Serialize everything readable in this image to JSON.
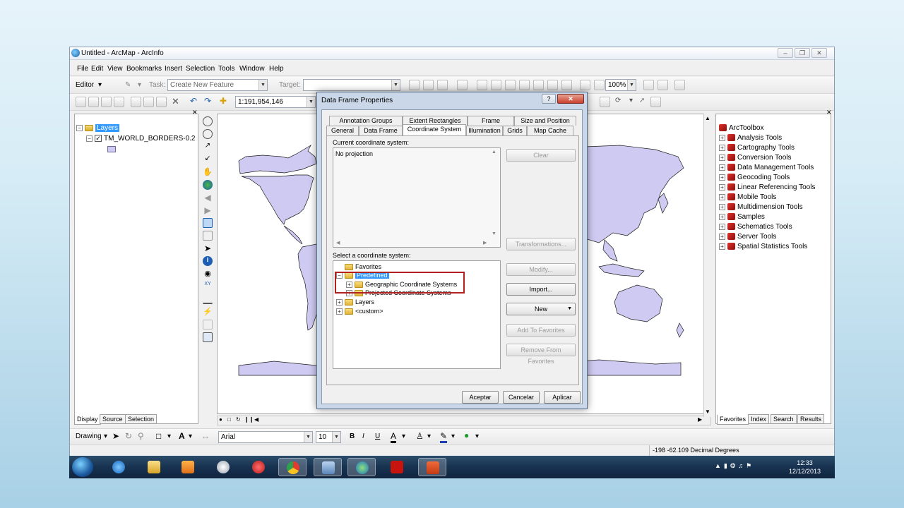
{
  "window": {
    "title": "Untitled - ArcMap - ArcInfo"
  },
  "menu": [
    "File",
    "Edit",
    "View",
    "Bookmarks",
    "Insert",
    "Selection",
    "Tools",
    "Window",
    "Help"
  ],
  "editor_toolbar": {
    "editor_label": "Editor",
    "task_label": "Task:",
    "task_value": "Create New Feature",
    "target_label": "Target:",
    "zoom_value": "100%"
  },
  "standard_toolbar": {
    "scale": "1:191,954,146"
  },
  "toc": {
    "root": "Layers",
    "layer": "TM_WORLD_BORDERS-0.2",
    "tabs": [
      "Display",
      "Source",
      "Selection"
    ]
  },
  "toolbox": {
    "root": "ArcToolbox",
    "items": [
      "Analysis Tools",
      "Cartography Tools",
      "Conversion Tools",
      "Data Management Tools",
      "Geocoding Tools",
      "Linear Referencing Tools",
      "Mobile Tools",
      "Multidimension Tools",
      "Samples",
      "Schematics Tools",
      "Server Tools",
      "Spatial Statistics Tools"
    ],
    "tabs": [
      "Favorites",
      "Index",
      "Search",
      "Results"
    ]
  },
  "drawing_toolbar": {
    "drawing_label": "Drawing",
    "font": "Arial",
    "size": "10",
    "bold": "B",
    "italic": "I",
    "underline": "U",
    "text_a": "A"
  },
  "status": {
    "coords": "-198  -62.109 Decimal Degrees"
  },
  "dialog": {
    "title": "Data Frame Properties",
    "help": "?",
    "tabs_row1": [
      "Annotation Groups",
      "Extent Rectangles",
      "Frame",
      "Size and Position"
    ],
    "tabs_row2": [
      "General",
      "Data Frame",
      "Coordinate System",
      "Illumination",
      "Grids",
      "Map Cache"
    ],
    "current_label": "Current coordinate system:",
    "current_value": "No projection",
    "select_label": "Select a coordinate system:",
    "tree": {
      "favorites": "Favorites",
      "predefined": "Predefined",
      "geographic": "Geographic Coordinate Systems",
      "projected": "Projected Coordinate Systems",
      "layers": "Layers",
      "custom": "<custom>"
    },
    "buttons": {
      "clear": "Clear",
      "transformations": "Transformations...",
      "modify": "Modify...",
      "import": "Import...",
      "new": "New",
      "add_fav": "Add To Favorites",
      "remove_fav": "Remove From Favorites",
      "ok": "Aceptar",
      "cancel": "Cancelar",
      "apply": "Aplicar"
    }
  },
  "taskbar": {
    "time": "12:33",
    "date": "12/12/2013"
  },
  "colors": {
    "land": "#cfcaf2",
    "highlight": "#b22020",
    "selection": "#3399ff"
  }
}
